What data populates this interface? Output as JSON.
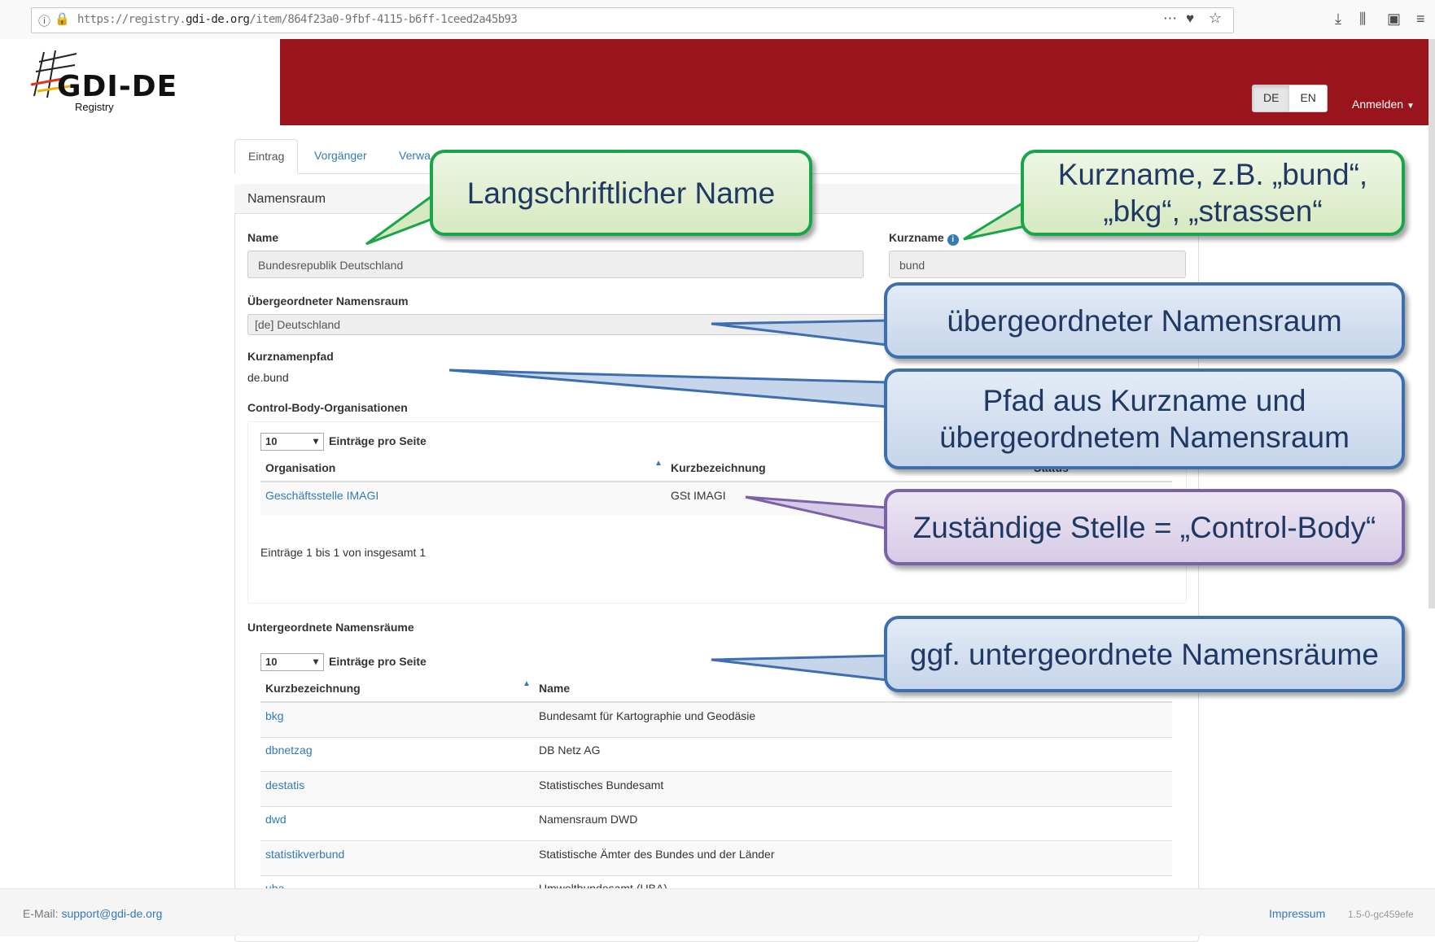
{
  "browser": {
    "url_prefix": "https://registry.",
    "url_domain": "gdi-de.org",
    "url_path": "/item/864f23a0-9fbf-4115-b6ff-1ceed2a45b93"
  },
  "header": {
    "logo_title": "GDI-DE",
    "logo_subtitle": "Registry",
    "lang_de": "DE",
    "lang_en": "EN",
    "login": "Anmelden",
    "brand_color": "#99141d"
  },
  "tabs": [
    {
      "label": "Eintrag"
    },
    {
      "label": "Vorgänger"
    },
    {
      "label": "Verwa"
    }
  ],
  "panel": {
    "title": "Namensraum",
    "name_label": "Name",
    "name_value": "Bundesrepublik Deutschland",
    "kurzname_label": "Kurzname",
    "kurzname_value": "bund",
    "parent_label": "Übergeordneter Namensraum",
    "parent_value": "[de] Deutschland",
    "path_label": "Kurznamenpfad",
    "path_value": "de.bund",
    "control_label": "Control-Body-Organisationen",
    "control_table": {
      "page_size": "10",
      "per_page_label": "Einträge pro Seite",
      "col_org": "Organisation",
      "col_short": "Kurzbezeichnung",
      "col_status": "Status",
      "rows": [
        {
          "org": "Geschäftsstelle IMAGI",
          "short": "GSt IMAGI"
        }
      ],
      "info": "Einträge 1 bis 1 von insgesamt 1"
    },
    "sub_label": "Untergeordnete Namensräume",
    "sub_table": {
      "page_size": "10",
      "per_page_label": "Einträge pro Seite",
      "col_short": "Kurzbezeichnung",
      "col_name": "Name",
      "rows": [
        {
          "short": "bkg",
          "name": "Bundesamt für Kartographie und Geodäsie"
        },
        {
          "short": "dbnetzag",
          "name": "DB Netz AG"
        },
        {
          "short": "destatis",
          "name": "Statistisches Bundesamt"
        },
        {
          "short": "dwd",
          "name": "Namensraum DWD"
        },
        {
          "short": "statistikverbund",
          "name": "Statistische Ämter des Bundes und der Länder"
        },
        {
          "short": "uba",
          "name": "Umweltbundesamt (UBA)"
        }
      ]
    }
  },
  "callouts": {
    "long_name": "Langschriftlicher Name",
    "short_name_line1": "Kurzname, z.B. „bund“,",
    "short_name_line2": "„bkg“, „strassen“",
    "parent": "übergeordneter Namensraum",
    "path_line1": "Pfad aus Kurzname und",
    "path_line2": "übergeordnetem Namensraum",
    "control": "Zuständige Stelle = „Control-Body“",
    "children": "ggf. untergeordnete Namensräume"
  },
  "footer": {
    "email_label": "E-Mail:",
    "email": "support@gdi-de.org",
    "impressum": "Impressum",
    "version": "1.5-0-gc459efe"
  }
}
